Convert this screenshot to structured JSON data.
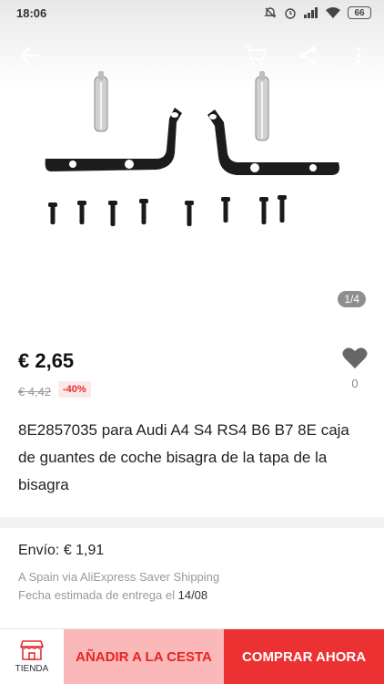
{
  "status_bar": {
    "time": "18:06",
    "battery": "66"
  },
  "gallery": {
    "page_indicator": "1/4"
  },
  "product": {
    "price": "€ 2,65",
    "old_price": "€ 4,42",
    "discount": "-40%",
    "wishlist_count": "0",
    "title": "8E2857035 para Audi A4 S4 RS4 B6 B7 8E caja de guantes de coche bisagra de la tapa de la bisagra"
  },
  "shipping": {
    "label": "Envío: ",
    "cost": "€ 1,91",
    "method": "A Spain via AliExpress Saver Shipping",
    "date_label": "Fecha estimada de entrega el ",
    "date": "14/08"
  },
  "bottom_bar": {
    "store_label": "TIENDA",
    "add_to_cart": "AÑADIR A LA CESTA",
    "buy_now": "COMPRAR AHORA"
  },
  "colors": {
    "accent": "#eb3131",
    "cart_bg": "#fbb8b8",
    "discount_text": "#e62e2e"
  },
  "icons": [
    "back-arrow-icon",
    "cart-icon",
    "share-icon",
    "more-icon",
    "heart-icon",
    "store-icon"
  ]
}
